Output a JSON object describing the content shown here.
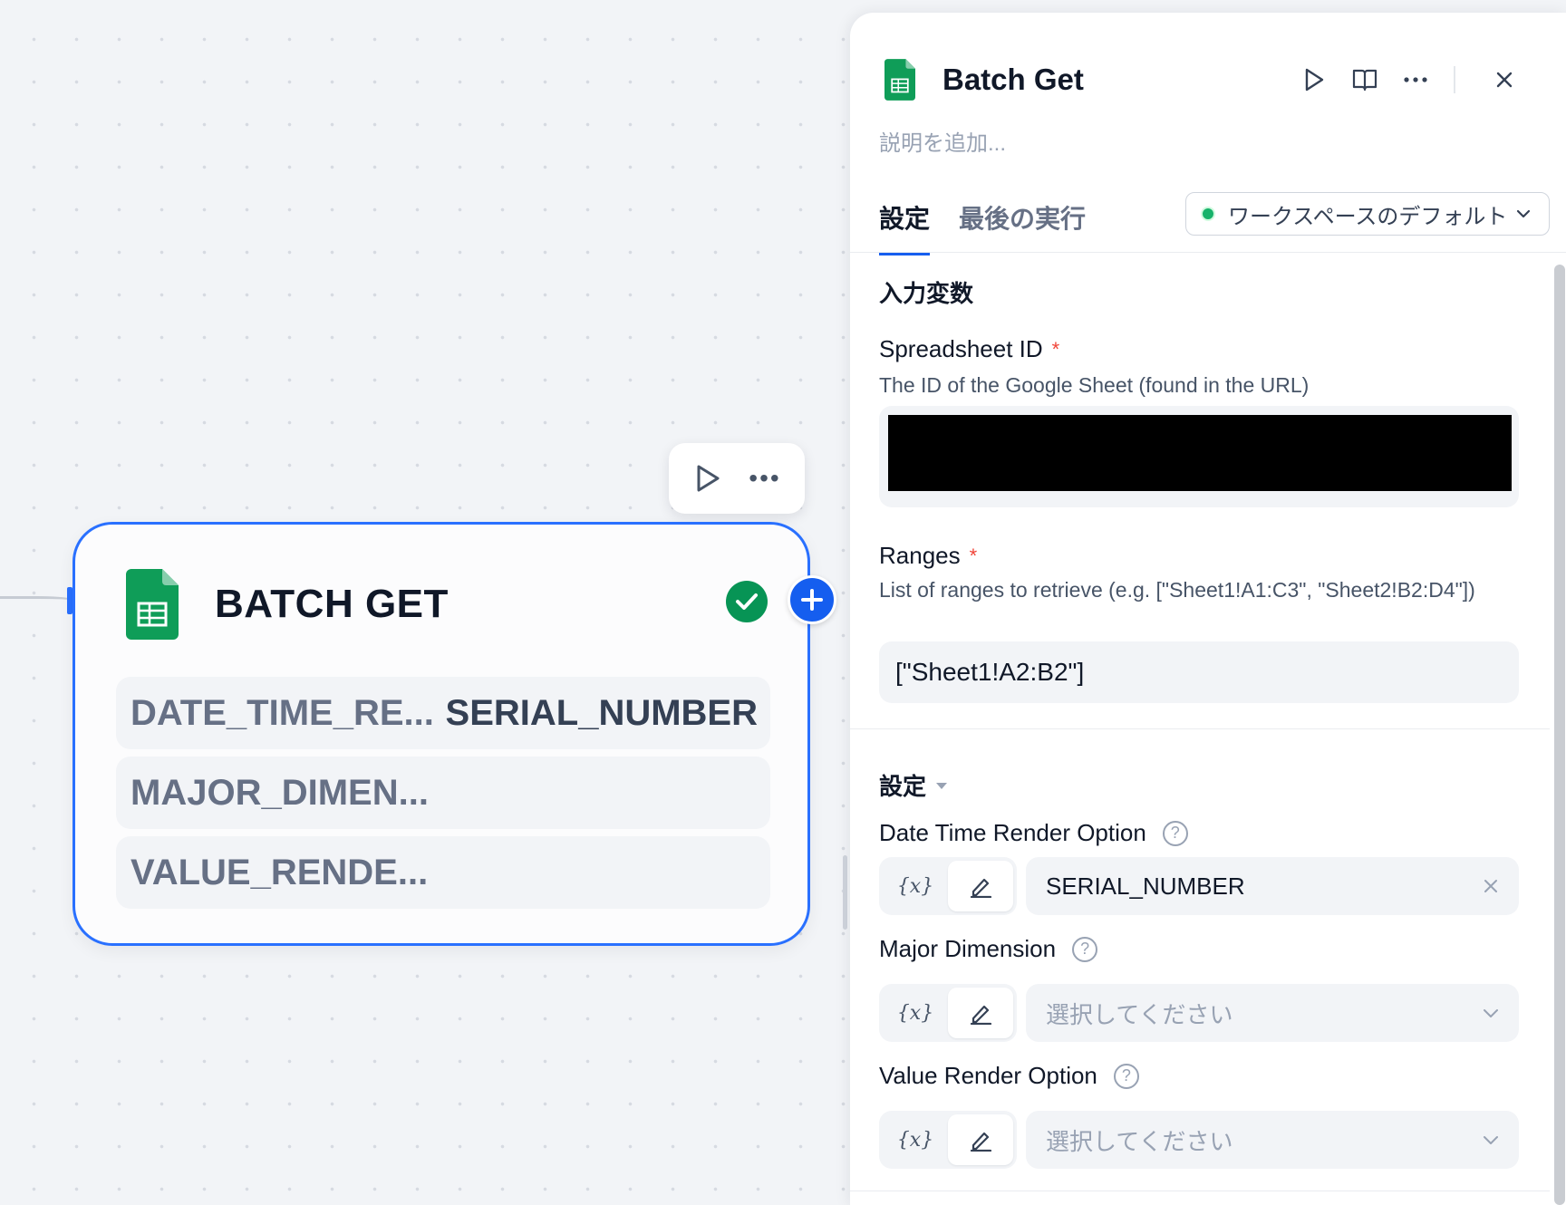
{
  "canvas": {
    "node": {
      "title": "BATCH GET",
      "rows": [
        {
          "label": "DATE_TIME_RE...",
          "value": "SERIAL_NUMBER"
        },
        {
          "label": "MAJOR_DIMEN...",
          "value": ""
        },
        {
          "label": "VALUE_RENDE...",
          "value": ""
        }
      ]
    },
    "toolbar": {
      "more_glyph": "•••"
    }
  },
  "panel": {
    "title": "Batch Get",
    "description_placeholder": "説明を追加...",
    "tabs": [
      {
        "label": "設定",
        "active": true
      },
      {
        "label": "最後の実行",
        "active": false
      }
    ],
    "environment": {
      "label": "ワークスペースのデフォルト",
      "status_color": "#17b26a"
    },
    "input_section": "入力変数",
    "spreadsheet_id": {
      "label": "Spreadsheet ID",
      "required_mark": "*",
      "help": "The ID of the Google Sheet (found in the URL)"
    },
    "ranges": {
      "label": "Ranges",
      "required_mark": "*",
      "help": "List of ranges to retrieve (e.g. [\"Sheet1!A1:C3\", \"Sheet2!B2:D4\"])",
      "value": "[\"Sheet1!A2:B2\"]"
    },
    "settings_section": "設定",
    "options": [
      {
        "label": "Date Time Render Option",
        "value": "SERIAL_NUMBER",
        "placeholder": ""
      },
      {
        "label": "Major Dimension",
        "value": "",
        "placeholder": "選択してください"
      },
      {
        "label": "Value Render Option",
        "value": "",
        "placeholder": "選択してください"
      }
    ],
    "var_toggle": "{x}",
    "help_glyph": "?"
  },
  "colors": {
    "accent": "#155eef",
    "node_border": "#2970ff",
    "success": "#079455",
    "sheets_green": "#0f9d58"
  }
}
